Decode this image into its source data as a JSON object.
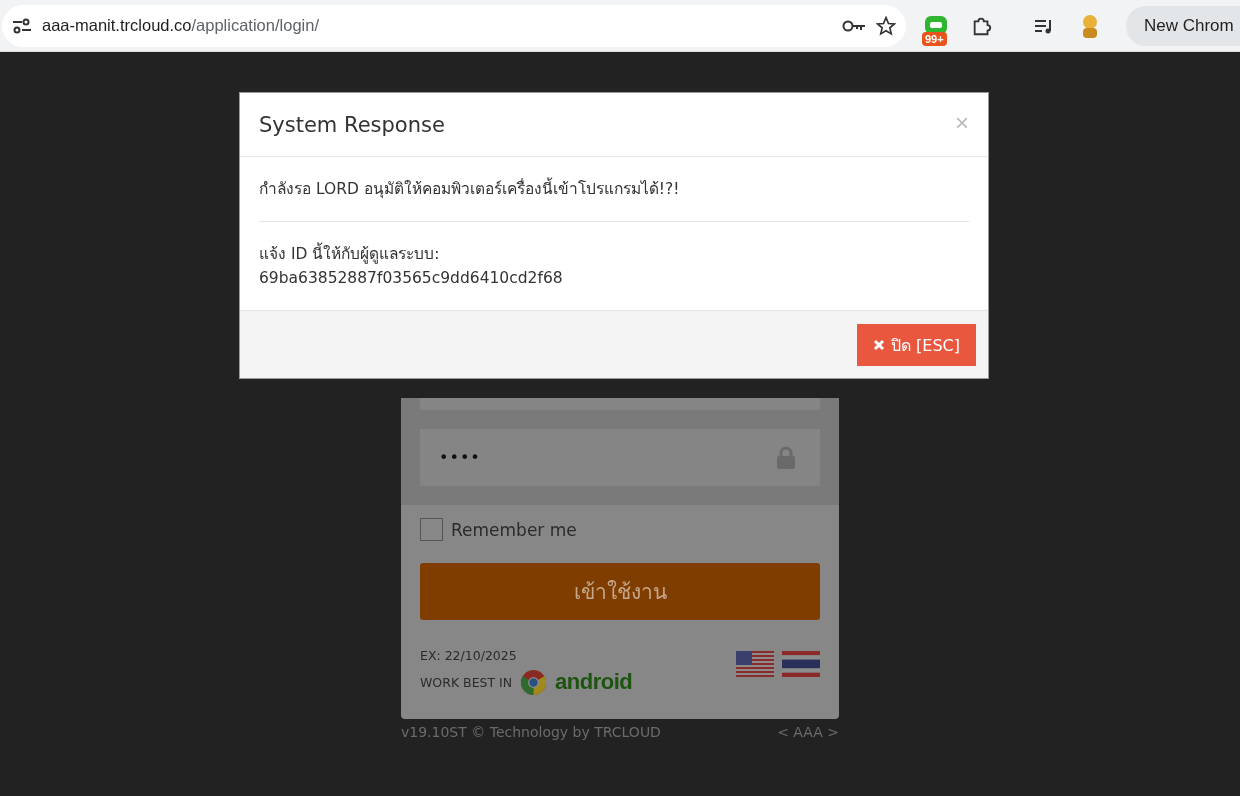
{
  "browser": {
    "url_host": "aaa-manit.trcloud.co",
    "url_path": "/application/login/",
    "badge": "99+",
    "profile_button": "New Chrom"
  },
  "login": {
    "password_value": "••••",
    "remember": {
      "label": "Remember me",
      "checked": false
    },
    "submit": "เข้าใช้งาน",
    "expiry": "EX: 22/10/2025",
    "work_best": "WORK BEST IN",
    "android": "android",
    "version": "v19.10ST © Technology by TRCLOUD",
    "nav": "< AAA >"
  },
  "modal": {
    "title": "System Response",
    "close": "×",
    "message": "กำลังรอ LORD อนุมัติให้คอมพิวเตอร์เครื่องนี้เข้าโปรแกรมได้!?!",
    "notice": "แจ้ง ID นี้ให้กับผู้ดูแลระบบ:",
    "id": "69ba63852887f03565c9dd6410cd2f68",
    "button": "ปิด [ESC]"
  }
}
